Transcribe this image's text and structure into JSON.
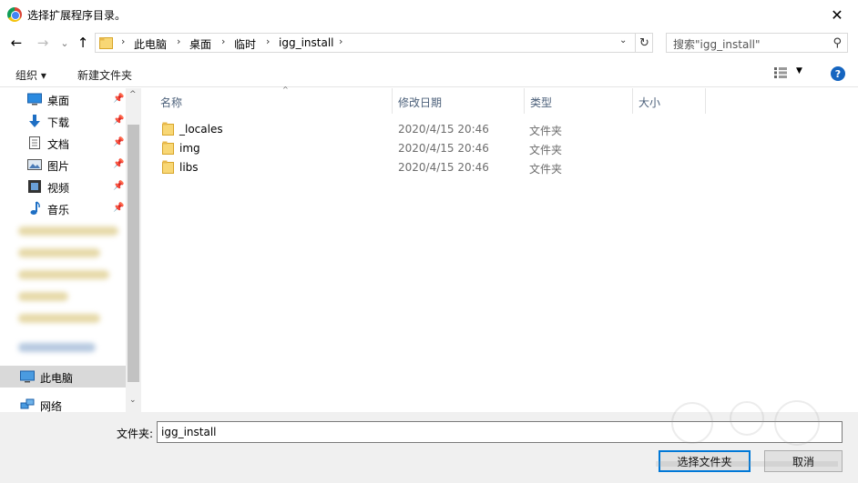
{
  "window": {
    "title": "选择扩展程序目录。",
    "close_glyph": "✕"
  },
  "nav": {
    "back_glyph": "←",
    "forward_glyph": "→",
    "history_glyph": "⌄",
    "up_glyph": "↑",
    "breadcrumbs": [
      "此电脑",
      "桌面",
      "临时",
      "igg_install"
    ],
    "separator": "›",
    "dropdown_glyph": "⌄",
    "refresh_glyph": "↻",
    "search_placeholder": "搜索\"igg_install\"",
    "search_glyph": "⚲"
  },
  "toolbar": {
    "organize_label": "组织 ▾",
    "new_folder_label": "新建文件夹",
    "view_dd_glyph": "▼",
    "help_glyph": "?"
  },
  "sidebar": {
    "pin_glyph": "📌",
    "quick_access": [
      {
        "label": "桌面",
        "icon": "desktop-icon"
      },
      {
        "label": "下载",
        "icon": "download-icon"
      },
      {
        "label": "文档",
        "icon": "document-icon"
      },
      {
        "label": "图片",
        "icon": "picture-icon"
      },
      {
        "label": "视频",
        "icon": "video-icon"
      },
      {
        "label": "音乐",
        "icon": "music-icon"
      }
    ],
    "this_pc": "此电脑",
    "network": "网络",
    "scroll_up_glyph": "^",
    "scroll_down_glyph": "⌄"
  },
  "columns": {
    "name": "名称",
    "modified": "修改日期",
    "type": "类型",
    "size": "大小",
    "sort_glyph": "^"
  },
  "files": [
    {
      "name": "_locales",
      "modified": "2020/4/15 20:46",
      "type": "文件夹"
    },
    {
      "name": "img",
      "modified": "2020/4/15 20:46",
      "type": "文件夹"
    },
    {
      "name": "libs",
      "modified": "2020/4/15 20:46",
      "type": "文件夹"
    }
  ],
  "footer": {
    "folder_label": "文件夹:",
    "folder_value": "igg_install",
    "select_button": "选择文件夹",
    "cancel_button": "取消"
  },
  "colors": {
    "accent": "#0078d7",
    "folder": "#f8d775",
    "selected_bg": "#d9d9d9",
    "header_text": "#4c607a"
  }
}
